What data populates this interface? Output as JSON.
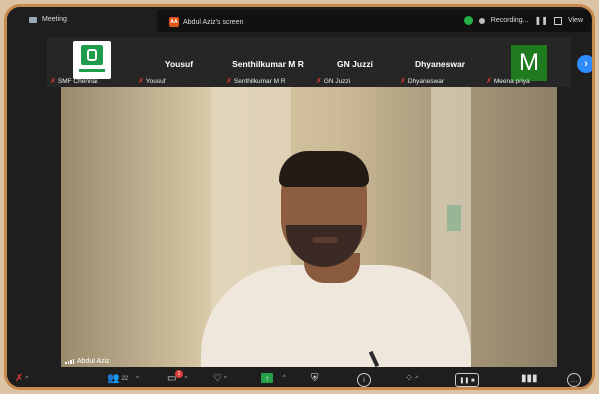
{
  "topbar": {
    "app_title": "Meeting",
    "share_owner_initials": "AA",
    "share_label": "Abdul Aziz's screen",
    "recording_label": "Recording...",
    "view_label": "View"
  },
  "participants": [
    {
      "display_name": "",
      "label": "SMF Chennai",
      "muted": true
    },
    {
      "display_name": "Yousuf",
      "label": "Yousuf",
      "muted": true
    },
    {
      "display_name": "Senthilkumar M R",
      "label": "Senthilkumar M R",
      "muted": true
    },
    {
      "display_name": "GN Juzzi",
      "label": "GN Juzzi",
      "muted": true
    },
    {
      "display_name": "Dhyaneswar",
      "label": "Dhyaneswar",
      "muted": true
    },
    {
      "display_name": "",
      "label": "Meena priya",
      "avatar_letter": "M",
      "muted": true
    }
  ],
  "main_video": {
    "speaker_label": "Abdul Aziz"
  },
  "toolbar": {
    "participants_count": "22",
    "chat_badge": "1"
  },
  "colors": {
    "frame_border": "#c98a4e",
    "accent_blue": "#2d8cff",
    "share_green": "#24a148",
    "mute_red": "#e03c3c",
    "avatar_green": "#1f7a20"
  }
}
